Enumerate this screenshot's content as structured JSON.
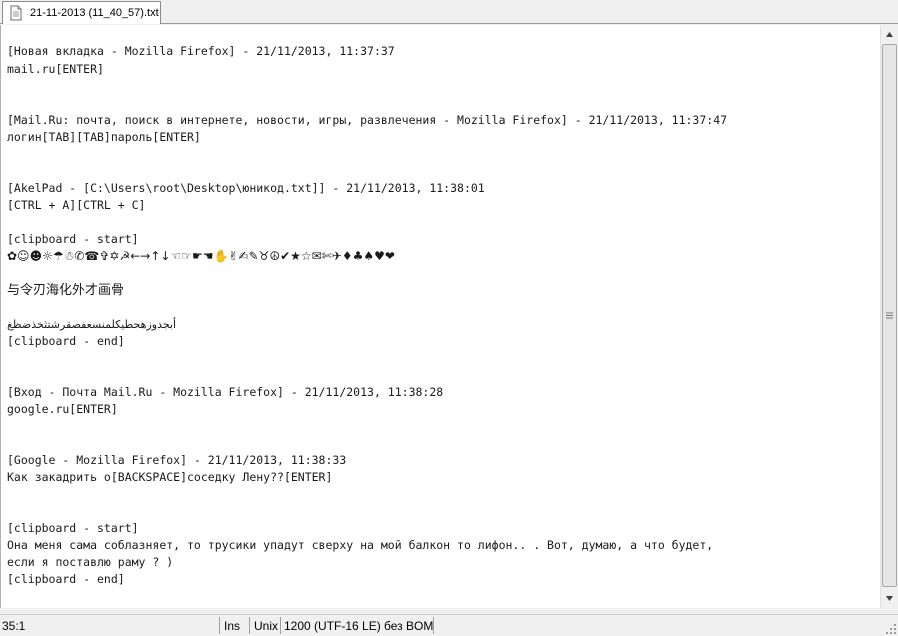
{
  "tab": {
    "title": "21-11-2013 (11_40_57).txt",
    "icon": "text-document-icon"
  },
  "document": {
    "lines": [
      {
        "text": "[Новая вкладка - Mozilla Firefox] - 21/11/2013, 11:37:37"
      },
      {
        "text": "mail.ru[ENTER]"
      },
      {
        "text": "[Mail.Ru: почта, поиск в интернете, новости, игры, развлечения - Mozilla Firefox] - 21/11/2013, 11:37:47"
      },
      {
        "text": "логин[TAB][TAB]пароль[ENTER]"
      },
      {
        "text": "[AkelPad - [C:\\Users\\root\\Desktop\\юникод.txt]] - 21/11/2013, 11:38:01"
      },
      {
        "text": "[CTRL + A][CTRL + C]"
      },
      {
        "text": "[clipboard - start]"
      },
      {
        "text": "✿☺☻☼☂☃✆☎✞✡☭←→↑↓☜☞☛☚✋✌✍✎♉☮✔★☆✉✄✈♦♣♠♥❤"
      },
      {
        "text": "与令刃海化外才画骨"
      },
      {
        "text": "أبجدوزهحطيكلمنسعفصقرشتثخذضظغ"
      },
      {
        "text": "[clipboard - end]"
      },
      {
        "text": "[Вход - Почта Mail.Ru - Mozilla Firefox] - 21/11/2013, 11:38:28"
      },
      {
        "text": "google.ru[ENTER]"
      },
      {
        "text": "[Google - Mozilla Firefox] - 21/11/2013, 11:38:33"
      },
      {
        "text": "Как закадрить о[BACKSPACE]соседку Лену??[ENTER]"
      },
      {
        "text": "[clipboard - start]"
      },
      {
        "text": "Она меня сама соблазняет, то трусики упадут сверху на мой балкон то лифон.. . Вот, думаю, а что будет,"
      },
      {
        "text": "если я поставлю раму ? )"
      },
      {
        "text": "[clipboard - end]"
      }
    ]
  },
  "statusbar": {
    "position": "35:1",
    "insert_mode": "Ins",
    "newline": "Unix",
    "encoding": "1200  (UTF-16 LE) без BOM"
  },
  "scrollbar": {
    "up_icon": "arrow-up-icon",
    "down_icon": "arrow-down-icon"
  }
}
